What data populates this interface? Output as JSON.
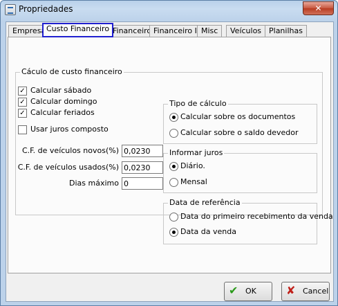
{
  "window": {
    "title": "Propriedades",
    "close_label": "✕"
  },
  "tabs": [
    {
      "label": "Empresa"
    },
    {
      "label": "Custo Financeiro"
    },
    {
      "label": "Financeiro"
    },
    {
      "label": "Financeiro II"
    },
    {
      "label": "Misc"
    },
    {
      "label": "Veículos"
    },
    {
      "label": "Planilhas"
    }
  ],
  "main_group": {
    "title": "Cáculo de custo financeiro",
    "checkboxes": [
      {
        "label": "Calcular sábado",
        "checked": true
      },
      {
        "label": "Calcular domingo",
        "checked": true
      },
      {
        "label": "Calcular feriados",
        "checked": true
      },
      {
        "label": "Usar juros composto",
        "checked": false
      }
    ],
    "fields": [
      {
        "label": "C.F. de veículos novos(%)",
        "value": "0,0230"
      },
      {
        "label": "C.F. de veículos usados(%)",
        "value": "0,0230"
      },
      {
        "label": "Dias máximo",
        "value": "0"
      }
    ]
  },
  "tipo_calculo": {
    "title": "Tipo de cálculo",
    "options": [
      {
        "label": "Calcular sobre os documentos",
        "selected": true
      },
      {
        "label": "Calcular sobre o saldo devedor",
        "selected": false
      }
    ]
  },
  "informar_juros": {
    "title": "Informar juros",
    "options": [
      {
        "label": "Diário.",
        "selected": true
      },
      {
        "label": "Mensal",
        "selected": false
      }
    ]
  },
  "data_referencia": {
    "title": "Data de referência",
    "options": [
      {
        "label": "Data do primeiro recebimento da venda",
        "selected": false
      },
      {
        "label": "Data da venda",
        "selected": true
      }
    ]
  },
  "buttons": {
    "ok_label": "OK",
    "cancel_label": "Cancel",
    "ok_icon": "check-icon",
    "cancel_icon": "x-icon"
  },
  "colors": {
    "ok_icon": "#2a9a1a",
    "cancel_icon": "#c0201a",
    "active_tab_outline": "#2020d0"
  }
}
